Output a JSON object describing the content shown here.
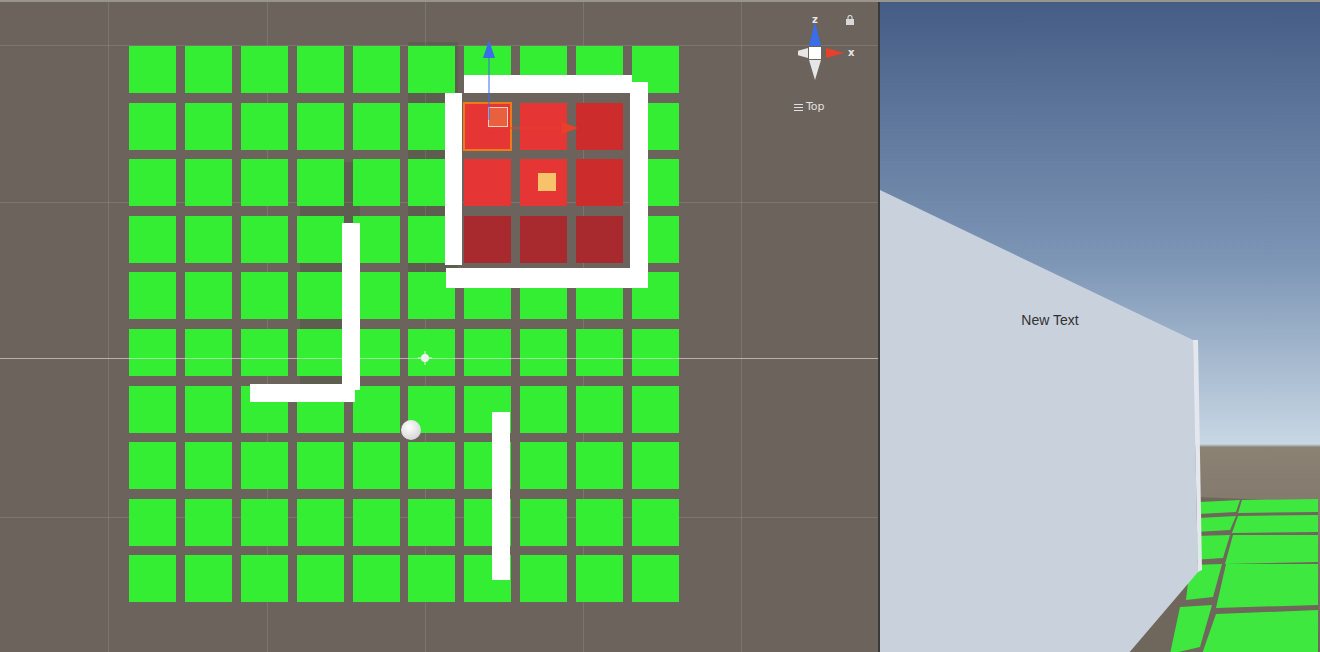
{
  "scene_view": {
    "gizmo": {
      "axes": [
        {
          "label": "z",
          "color": "#3a6ee8"
        },
        {
          "label": "x",
          "color": "#e8402a"
        }
      ],
      "view": "Top",
      "locked": false
    },
    "tiles": {
      "rows": [
        [
          "#33ee33",
          "#33ee33",
          "#33ee33",
          "#33ee33",
          "#33ee33",
          "#33ee33",
          "#33ee33",
          "#33ee33",
          "#33ee33",
          "#33ee33"
        ],
        [
          "#33ee33",
          "#33ee33",
          "#33ee33",
          "#33ee33",
          "#33ee33",
          "#33ee33",
          "#e53535",
          "#e53535",
          "#cc2c2c",
          "#33ee33"
        ],
        [
          "#33ee33",
          "#33ee33",
          "#33ee33",
          "#33ee33",
          "#33ee33",
          "#33ee33",
          "#e53535",
          "#e53535",
          "#cc2c2c",
          "#33ee33"
        ],
        [
          "#33ee33",
          "#33ee33",
          "#33ee33",
          "#33ee33",
          "#33ee33",
          "#33ee33",
          "#a82a2e",
          "#a82a2e",
          "#a82a2e",
          "#33ee33"
        ],
        [
          "#33ee33",
          "#33ee33",
          "#33ee33",
          "#33ee33",
          "#33ee33",
          "#33ee33",
          "#33ee33",
          "#33ee33",
          "#33ee33",
          "#33ee33"
        ],
        [
          "#33ee33",
          "#33ee33",
          "#33ee33",
          "#33ee33",
          "#33ee33",
          "#33ee33",
          "#33ee33",
          "#33ee33",
          "#33ee33",
          "#33ee33"
        ],
        [
          "#33ee33",
          "#33ee33",
          "#33ee33",
          "#33ee33",
          "#33ee33",
          "#33ee33",
          "#33ee33",
          "#33ee33",
          "#33ee33",
          "#33ee33"
        ],
        [
          "#33ee33",
          "#33ee33",
          "#33ee33",
          "#33ee33",
          "#33ee33",
          "#33ee33",
          "#33ee33",
          "#33ee33",
          "#33ee33",
          "#33ee33"
        ],
        [
          "#33ee33",
          "#33ee33",
          "#33ee33",
          "#33ee33",
          "#33ee33",
          "#33ee33",
          "#33ee33",
          "#33ee33",
          "#33ee33",
          "#33ee33"
        ],
        [
          "#33ee33",
          "#33ee33",
          "#33ee33",
          "#33ee33",
          "#33ee33",
          "#33ee33",
          "#33ee33",
          "#33ee33",
          "#33ee33",
          "#33ee33"
        ]
      ],
      "selected": {
        "row": 1,
        "col": 6
      }
    }
  },
  "game_view": {
    "label": "New Text"
  }
}
